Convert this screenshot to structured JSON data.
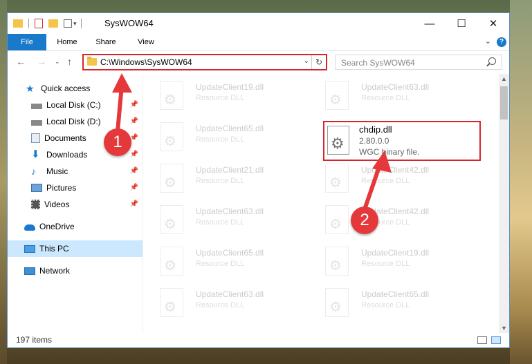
{
  "window": {
    "title": "SysWOW64",
    "minimize": "—",
    "maximize": "☐",
    "close": "✕"
  },
  "ribbon": {
    "tabs": [
      "File",
      "Home",
      "Share",
      "View"
    ],
    "help": "?"
  },
  "address": {
    "path": "C:\\Windows\\SysWOW64",
    "search_placeholder": "Search SysWOW64"
  },
  "sidebar": {
    "items": [
      {
        "label": "Quick access",
        "icon": "star-icon"
      },
      {
        "label": "Local Disk (C:)",
        "icon": "drive-icon"
      },
      {
        "label": "Local Disk (D:)",
        "icon": "drive-icon"
      },
      {
        "label": "Documents",
        "icon": "documents-icon"
      },
      {
        "label": "Downloads",
        "icon": "download-icon"
      },
      {
        "label": "Music",
        "icon": "music-icon"
      },
      {
        "label": "Pictures",
        "icon": "pictures-icon"
      },
      {
        "label": "Videos",
        "icon": "videos-icon"
      },
      {
        "label": "OneDrive",
        "icon": "cloud-icon"
      },
      {
        "label": "This PC",
        "icon": "computer-icon"
      },
      {
        "label": "Network",
        "icon": "network-icon"
      }
    ]
  },
  "files": [
    {
      "name": "UpdateClient19.dll",
      "type": "Resource DLL"
    },
    {
      "name": "UpdateClient63.dll",
      "type": "Resource DLL"
    },
    {
      "name": "UpdateClient65.dll",
      "type": "Resource DLL"
    },
    {
      "name": "UpdateClient21.dll",
      "type": "Resource DLL"
    },
    {
      "name": "UpdateClient42.dll",
      "type": "Resource DLL"
    },
    {
      "name": "UpdateClient63.dll",
      "type": "Resource DLL"
    },
    {
      "name": "UpdateClient42.dll",
      "type": "Resource DLL"
    },
    {
      "name": "UpdateClient65.dll",
      "type": "Resource DLL"
    },
    {
      "name": "UpdateClient19.dll",
      "type": "Resource DLL"
    },
    {
      "name": "UpdateClient63.dll",
      "type": "Resource DLL"
    },
    {
      "name": "UpdateClient65.dll",
      "type": "Resource DLL"
    }
  ],
  "highlighted_file": {
    "name": "chdip.dll",
    "version": "2.80.0.0",
    "description": "WGC binary file."
  },
  "status": {
    "item_count": "197 items"
  },
  "annotations": [
    "1",
    "2"
  ],
  "colors": {
    "accent": "#1979ca",
    "annotation_red": "#e5383b",
    "selection": "#cce8ff"
  }
}
